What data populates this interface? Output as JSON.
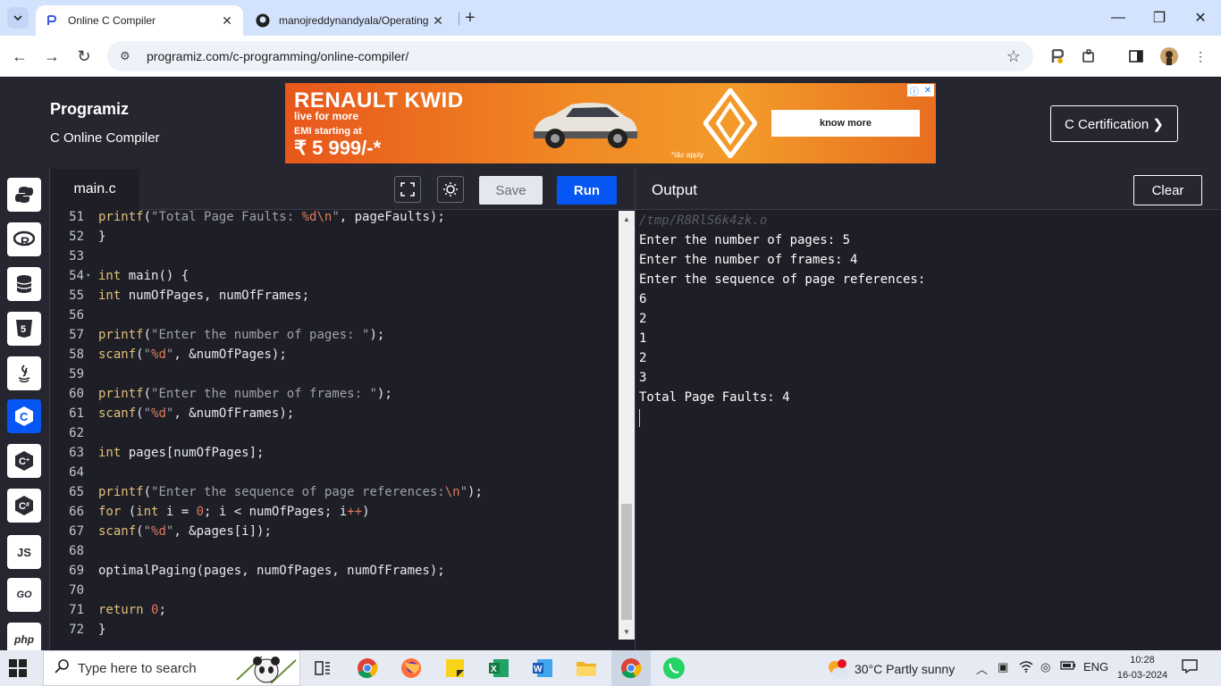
{
  "browser": {
    "tabs": [
      {
        "title": "Online C Compiler",
        "active": true
      },
      {
        "title": "manojreddynandyala/Operating",
        "active": false
      }
    ],
    "url": "programiz.com/c-programming/online-compiler/"
  },
  "header": {
    "logo": "Programiz",
    "subtitle": "C Online Compiler",
    "cert_button": "C Certification ❯"
  },
  "ad": {
    "brand": "RENAULT KWID",
    "tagline": "live for more",
    "emi_label": "EMI starting at",
    "price": "₹ 5 999/-*",
    "cta": "know more",
    "disclaimer": "*t&c apply"
  },
  "languages": [
    "python",
    "r",
    "sql",
    "html",
    "java",
    "c",
    "cpp",
    "csharp",
    "JS",
    "GO",
    "php"
  ],
  "editor": {
    "file_name": "main.c",
    "save_label": "Save",
    "run_label": "Run"
  },
  "code_lines": [
    {
      "n": "51",
      "html": "<span class=\"k\">printf</span>(<span class=\"s\">\"Total Page Faults: </span><span class=\"e\">%d\\n</span><span class=\"s\">\"</span>, pageFaults);"
    },
    {
      "n": "52",
      "html": "}"
    },
    {
      "n": "53",
      "html": ""
    },
    {
      "n": "54",
      "html": "<span class=\"k\">int</span> main() {",
      "fold": true
    },
    {
      "n": "55",
      "html": "<span class=\"k\">int</span> numOfPages, numOfFrames;"
    },
    {
      "n": "56",
      "html": ""
    },
    {
      "n": "57",
      "html": "<span class=\"k\">printf</span>(<span class=\"s\">\"Enter the number of pages: \"</span>);"
    },
    {
      "n": "58",
      "html": "<span class=\"k\">scanf</span>(<span class=\"s\">\"</span><span class=\"e\">%d</span><span class=\"s\">\"</span>, &numOfPages);"
    },
    {
      "n": "59",
      "html": ""
    },
    {
      "n": "60",
      "html": "<span class=\"k\">printf</span>(<span class=\"s\">\"Enter the number of frames: \"</span>);"
    },
    {
      "n": "61",
      "html": "<span class=\"k\">scanf</span>(<span class=\"s\">\"</span><span class=\"e\">%d</span><span class=\"s\">\"</span>, &numOfFrames);"
    },
    {
      "n": "62",
      "html": ""
    },
    {
      "n": "63",
      "html": "<span class=\"k\">int</span> pages[numOfPages];"
    },
    {
      "n": "64",
      "html": ""
    },
    {
      "n": "65",
      "html": "<span class=\"k\">printf</span>(<span class=\"s\">\"Enter the sequence of page references:</span><span class=\"e\">\\n</span><span class=\"s\">\"</span>);"
    },
    {
      "n": "66",
      "html": "<span class=\"k\">for</span> (<span class=\"k\">int</span> i = <span class=\"n\">0</span>; i &lt; numOfPages; i<span class=\"e\">++</span>)"
    },
    {
      "n": "67",
      "html": "<span class=\"k\">scanf</span>(<span class=\"s\">\"</span><span class=\"e\">%d</span><span class=\"s\">\"</span>, &pages[i]);"
    },
    {
      "n": "68",
      "html": ""
    },
    {
      "n": "69",
      "html": "optimalPaging(pages, numOfPages, numOfFrames);"
    },
    {
      "n": "70",
      "html": ""
    },
    {
      "n": "71",
      "html": "<span class=\"k\">return</span> <span class=\"n\">0</span>;"
    },
    {
      "n": "72",
      "html": "}"
    }
  ],
  "output": {
    "title": "Output",
    "clear_label": "Clear",
    "path": "/tmp/R8RlS6k4zk.o",
    "lines": [
      "Enter the number of pages: 5",
      "Enter the number of frames: 4",
      "Enter the sequence of page references:",
      "6",
      "2",
      "1",
      "2",
      "3",
      "Total Page Faults: 4"
    ]
  },
  "taskbar": {
    "search_placeholder": "Type here to search",
    "weather": "30°C  Partly sunny",
    "language": "ENG",
    "time": "10:28",
    "date": "16-03-2024"
  }
}
